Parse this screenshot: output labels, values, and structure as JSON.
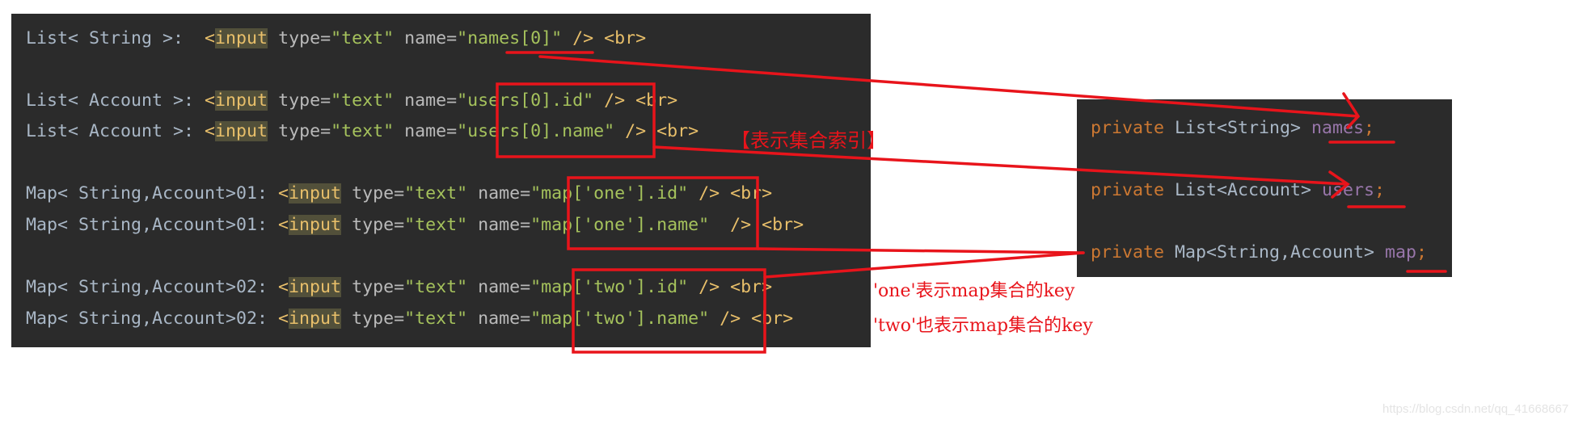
{
  "left_code": {
    "lines": [
      {
        "label": "List< String >:  ",
        "attr_type": "type=",
        "type_val": "\"text\"",
        "attr_name": " name=",
        "name_val": "\"names[0]\"",
        "tail": " /> <br>"
      },
      {
        "label": "List< Account >: ",
        "attr_type": "type=",
        "type_val": "\"text\"",
        "attr_name": " name=",
        "name_val": "\"users[0].id\"",
        "tail": " /> <br>"
      },
      {
        "label": "List< Account >: ",
        "attr_type": "type=",
        "type_val": "\"text\"",
        "attr_name": " name=",
        "name_val": "\"users[0].name\"",
        "tail": " /> <br>"
      },
      {
        "label": "Map< String,Account>01: ",
        "attr_type": "type=",
        "type_val": "\"text\"",
        "attr_name": " name=",
        "name_val": "\"map['one'].id\"",
        "tail": " /> <br>"
      },
      {
        "label": "Map< String,Account>01: ",
        "attr_type": "type=",
        "type_val": "\"text\"",
        "attr_name": " name=",
        "name_val": "\"map['one'].name\"",
        "tail": "  /> <br>"
      },
      {
        "label": "Map< String,Account>02: ",
        "attr_type": "type=",
        "type_val": "\"text\"",
        "attr_name": " name=",
        "name_val": "\"map['two'].id\"",
        "tail": " /> <br>"
      },
      {
        "label": "Map< String,Account>02: ",
        "attr_type": "type=",
        "type_val": "\"text\"",
        "attr_name": " name=",
        "name_val": "\"map['two'].name\"",
        "tail": " /> <br>"
      }
    ],
    "tag_open": "<",
    "tag_name": "input"
  },
  "right_code": {
    "lines": [
      {
        "keyword": "private",
        "type": " List<String> ",
        "field": "names",
        "semi": ";"
      },
      {
        "keyword": "private",
        "type": " List<Account> ",
        "field": "users",
        "semi": ";"
      },
      {
        "keyword": "private",
        "type": " Map<String,Account> ",
        "field": "map",
        "semi": ";"
      }
    ]
  },
  "annotations": {
    "collection_index": "【表示集合索引】",
    "one_key": "'one'表示map集合的key",
    "two_key": "'two'也表示map集合的key"
  },
  "watermark": "https://blog.csdn.net/qq_41668667",
  "colors": {
    "background": "#2b2b2b",
    "annotation_red": "#e8141b",
    "string_green": "#a5c25c",
    "tag_yellow": "#e8bf6a",
    "keyword_orange": "#cc7832",
    "field_purple": "#9876aa"
  }
}
